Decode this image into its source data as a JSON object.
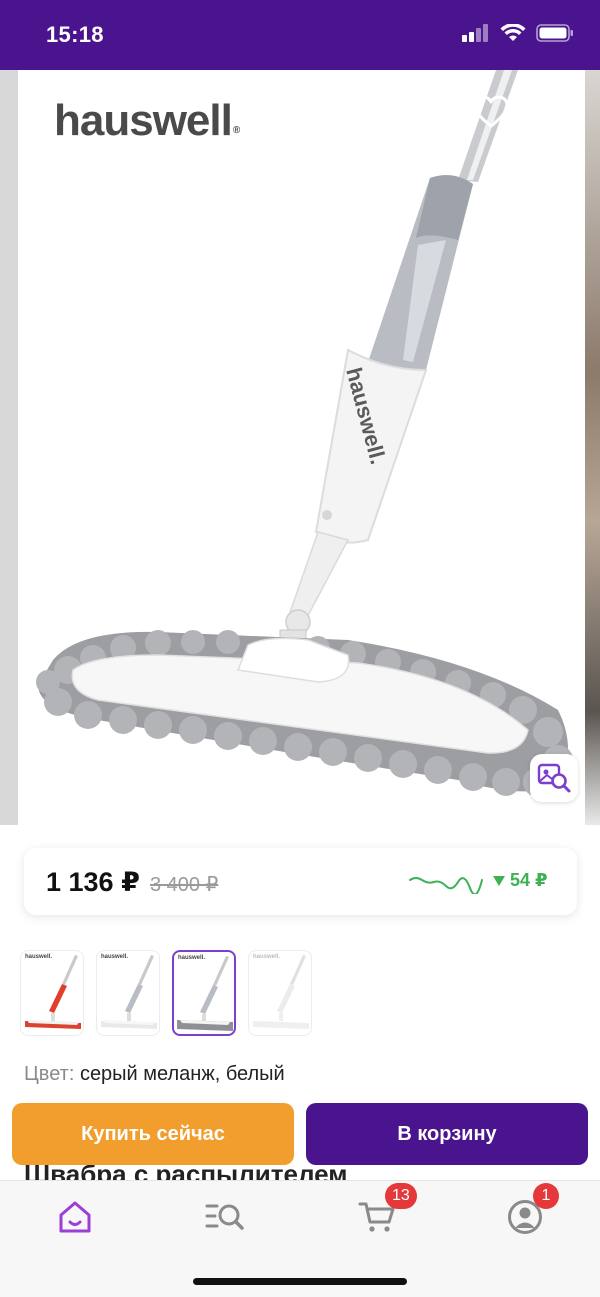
{
  "status_bar": {
    "time": "15:18"
  },
  "gallery": {
    "brand": "hauswell",
    "brand_mark": "®",
    "product_print": "hauswell."
  },
  "price": {
    "current": "1 136 ₽",
    "old": "3 400 ₽",
    "drop": "54 ₽"
  },
  "thumbnails": [
    {
      "brand": "hauswell.",
      "variant": "red-white",
      "active": false
    },
    {
      "brand": "hauswell.",
      "variant": "white",
      "active": false
    },
    {
      "brand": "hauswell.",
      "variant": "grey-melange",
      "active": true
    },
    {
      "brand": "hauswell.",
      "variant": "white-pale",
      "active": false
    }
  ],
  "color": {
    "label": "Цвет:",
    "value": "серый меланж, белый"
  },
  "product_title": "Швабра с распылителем",
  "actions": {
    "buy_now": "Купить сейчас",
    "add_to_cart": "В корзину"
  },
  "tabbar": {
    "cart_badge": "13",
    "profile_badge": "1"
  },
  "colors": {
    "brand_purple": "#4b148f",
    "accent_orange": "#f19e2e",
    "price_down_green": "#3db255",
    "badge_red": "#e5383b"
  }
}
